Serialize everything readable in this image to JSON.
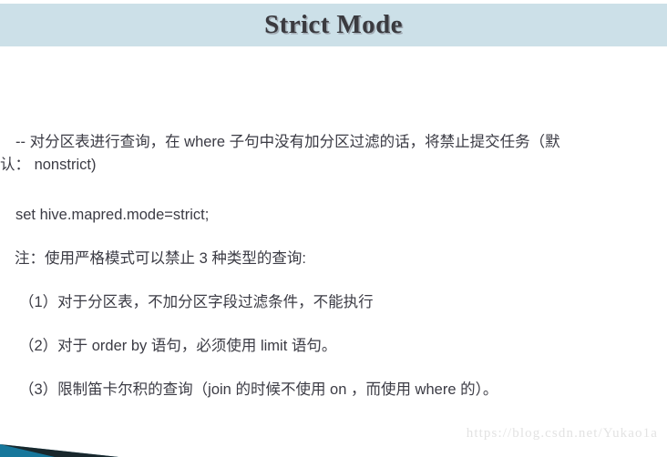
{
  "slide": {
    "title": "Strict Mode",
    "background_color": "#ffffff",
    "title_bar_color": "#cce0e8",
    "title_text_color": "#3a3a3f",
    "body_text_color": "#3b3b44",
    "accent_color": "#17779b"
  },
  "content": {
    "comment_line": {
      "lead": "-- 对分区表进行查询，在 where 子句中没有加分区过滤的话，将禁止提交任务（默",
      "continuation": "认：  nonstrict)"
    },
    "set_statement": "set hive.mapred.mode=strict;",
    "note": "注：使用严格模式可以禁止 3 种类型的查询:",
    "items": [
      "（1）对于分区表，不加分区字段过滤条件，不能执行",
      "（2）对于 order by 语句，必须使用 limit 语句。",
      "（3）限制笛卡尔积的查询（join 的时候不使用 on ，而使用 where 的）。"
    ]
  },
  "watermark": {
    "text": "https://blog.csdn.net/Yukao1a",
    "color": "#e3e3e3"
  }
}
